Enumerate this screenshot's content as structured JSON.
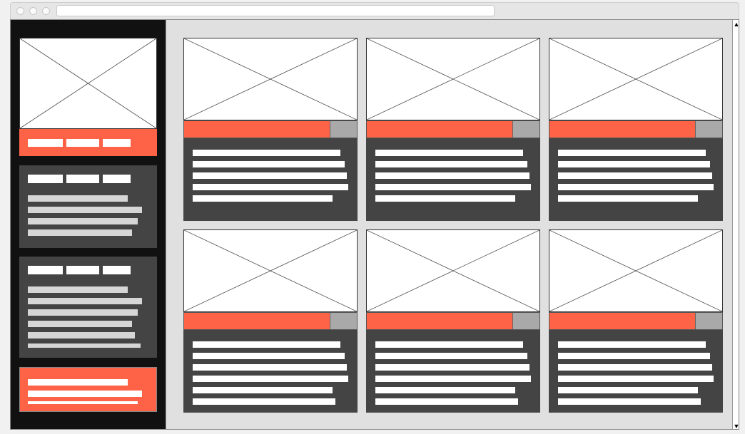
{
  "colors": {
    "accent": "#ff6347",
    "sidebar_bg": "#111111",
    "panel_bg": "#444444",
    "main_bg": "#e0e0e0",
    "placeholder_bg": "#ffffff",
    "secondary_button": "#a9a9a9"
  },
  "icons": {
    "window_buttons": [
      "window-close-icon",
      "window-minimize-icon",
      "window-maximize-icon"
    ],
    "scroll_up": "▲",
    "scroll_down": "▼",
    "image_placeholder": "image-placeholder-icon"
  },
  "browser": {
    "address_text": ""
  },
  "sidebar": {
    "nav_blocks": 3,
    "panels": 2
  },
  "cards": 6
}
